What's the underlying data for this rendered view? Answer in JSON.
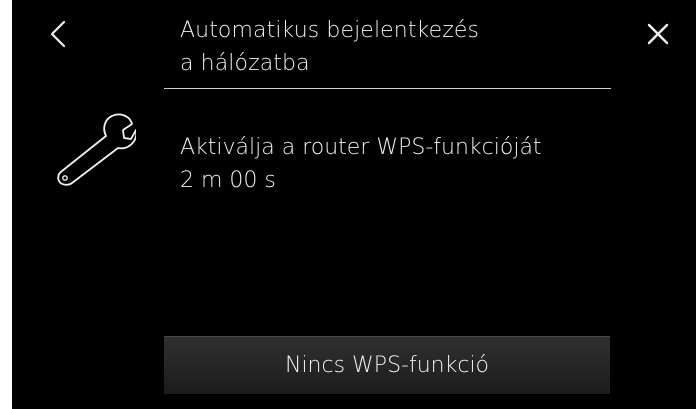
{
  "header": {
    "title_line1": "Automatikus bejelentkezés",
    "title_line2": "a hálózatba"
  },
  "navigation": {
    "back_icon": "chevron-left-icon",
    "close_icon": "close-icon"
  },
  "content": {
    "icon": "wrench-icon",
    "instruction": "Aktiválja a router WPS-funkcióját",
    "timer": "2 m 00 s"
  },
  "footer": {
    "no_wps_label": "Nincs WPS-funkció"
  }
}
